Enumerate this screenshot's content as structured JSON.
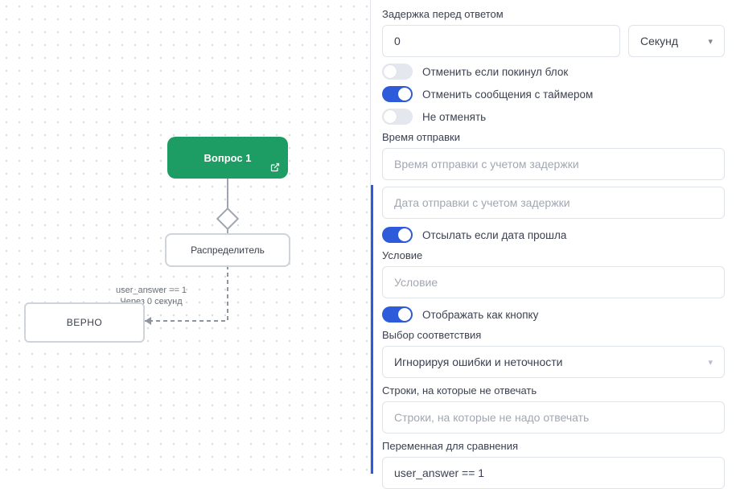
{
  "canvas": {
    "question_node": "Вопрос 1",
    "distributor_node": "Распределитель",
    "verno_node": "ВЕРНО",
    "edge_label_line1": "user_answer == 1",
    "edge_label_line2": "Через 0 секунд"
  },
  "panel": {
    "delay_label": "Задержка перед ответом",
    "delay_value": "0",
    "delay_unit": "Секунд",
    "t_cancel_left": "Отменить если покинул блок",
    "t_cancel_timer": "Отменить сообщения с таймером",
    "t_no_cancel": "Не отменять",
    "send_time_label": "Время отправки",
    "send_time_placeholder": "Время отправки с учетом задержки",
    "send_date_placeholder": "Дата отправки с учетом задержки",
    "t_send_past": "Отсылать если дата прошла",
    "condition_label": "Условие",
    "condition_placeholder": "Условие",
    "t_as_button": "Отображать как кнопку",
    "match_label": "Выбор соответствия",
    "match_value": "Игнорируя ошибки и неточности",
    "ignore_label": "Строки, на которые не отвечать",
    "ignore_placeholder": "Строки, на которые не надо отвечать",
    "var_label": "Переменная для сравнения",
    "var_value": "user_answer == 1"
  }
}
